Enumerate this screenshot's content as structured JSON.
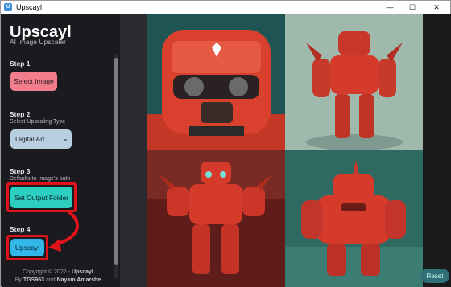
{
  "window": {
    "title": "Upscayl",
    "app_icon_letter": "U",
    "minimize_symbol": "—",
    "maximize_symbol": "☐",
    "close_symbol": "✕"
  },
  "sidebar": {
    "app_name": "Upscayl",
    "app_subtitle": "AI Image Upscaler",
    "step1": {
      "label": "Step 1",
      "button": "Select Image"
    },
    "step2": {
      "label": "Step 2",
      "sublabel": "Select Upscaling Type",
      "selected_option": "Digital Art"
    },
    "step3": {
      "label": "Step 3",
      "sublabel": "Defaults to Image's path",
      "button": "Set Output Folder"
    },
    "step4": {
      "label": "Step 4",
      "button": "Upscayl"
    },
    "footer": {
      "copyright_prefix": "Copyright © 2022 - ",
      "copyright_name": "Upscayl",
      "by_prefix": "By ",
      "author1": "TGS963",
      "and_text": " and ",
      "author2": "Nayam Amarshe"
    }
  },
  "main": {
    "reset_button": "Reset",
    "preview_description_tiles": [
      "robot-face-closeup",
      "robot-full-body-teal",
      "robot-crouching-red",
      "robot-heavy-teal"
    ]
  },
  "colors": {
    "background": "#1b1b1f",
    "select_button": "#f27d8d",
    "output_button": "#2ccfbf",
    "upscayl_button": "#31b7e8",
    "highlight": "#e0131b",
    "robot_red": "#d63a2a"
  },
  "icons": {
    "app": "upscayl-app-icon",
    "dropdown": "chevron-down-icon",
    "arrow": "curved-arrow-annotation"
  }
}
